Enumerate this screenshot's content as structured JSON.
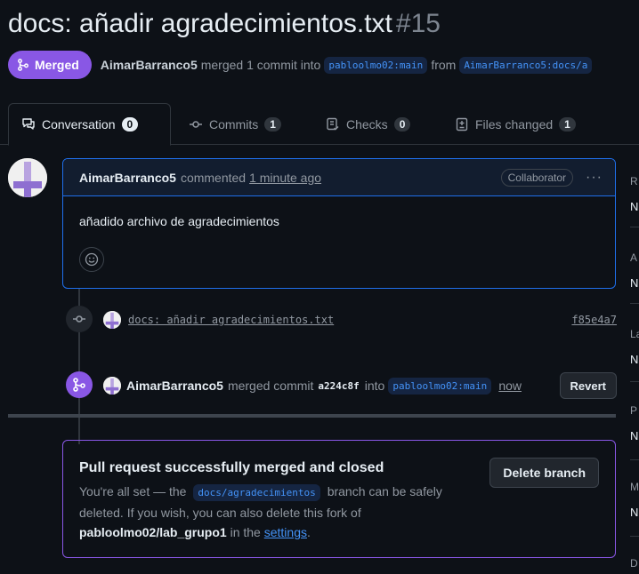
{
  "pr": {
    "title": "docs: añadir agradecimientos.txt",
    "number": "#15",
    "status": "Merged",
    "author": "AimarBarranco5",
    "merge_text": "merged 1 commit into",
    "base_branch": "pabloolmo02:main",
    "from_text": "from",
    "head_branch": "AimarBarranco5:docs/a"
  },
  "tabs": [
    {
      "label": "Conversation",
      "count": "0"
    },
    {
      "label": "Commits",
      "count": "1"
    },
    {
      "label": "Checks",
      "count": "0"
    },
    {
      "label": "Files changed",
      "count": "1"
    }
  ],
  "comment": {
    "author": "AimarBarranco5",
    "action": "commented",
    "time": "1 minute ago",
    "role": "Collaborator",
    "menu": "···",
    "body": "añadido archivo de agradecimientos"
  },
  "commit": {
    "message": "docs: añadir agradecimientos.txt",
    "sha": "f85e4a7"
  },
  "merge_event": {
    "author": "AimarBarranco5",
    "text": "merged commit",
    "sha": "a224c8f",
    "into": "into",
    "branch": "pabloolmo02:main",
    "time": "now",
    "revert_label": "Revert"
  },
  "merged_box": {
    "title": "Pull request successfully merged and closed",
    "desc_1": "You're all set — the",
    "branch": "docs/agradecimientos",
    "desc_2": "branch can be safely deleted. If you wish, you can also delete this fork of",
    "repo": "pabloolmo02/lab_grupo1",
    "desc_3": "in the",
    "link": "settings",
    "desc_4": ".",
    "delete_label": "Delete branch"
  },
  "sidebar": {
    "sections": [
      {
        "label": "R",
        "value": "N"
      },
      {
        "label": "A",
        "value": "N"
      },
      {
        "label": "La",
        "value": "N"
      },
      {
        "label": "P",
        "value": "N"
      },
      {
        "label": "M",
        "value": "N"
      },
      {
        "label": "D",
        "value": ""
      }
    ]
  },
  "colors": {
    "background": "#0d1117",
    "merged_purple": "#8957e5",
    "link_blue": "#4493f8",
    "border": "#30363d"
  }
}
